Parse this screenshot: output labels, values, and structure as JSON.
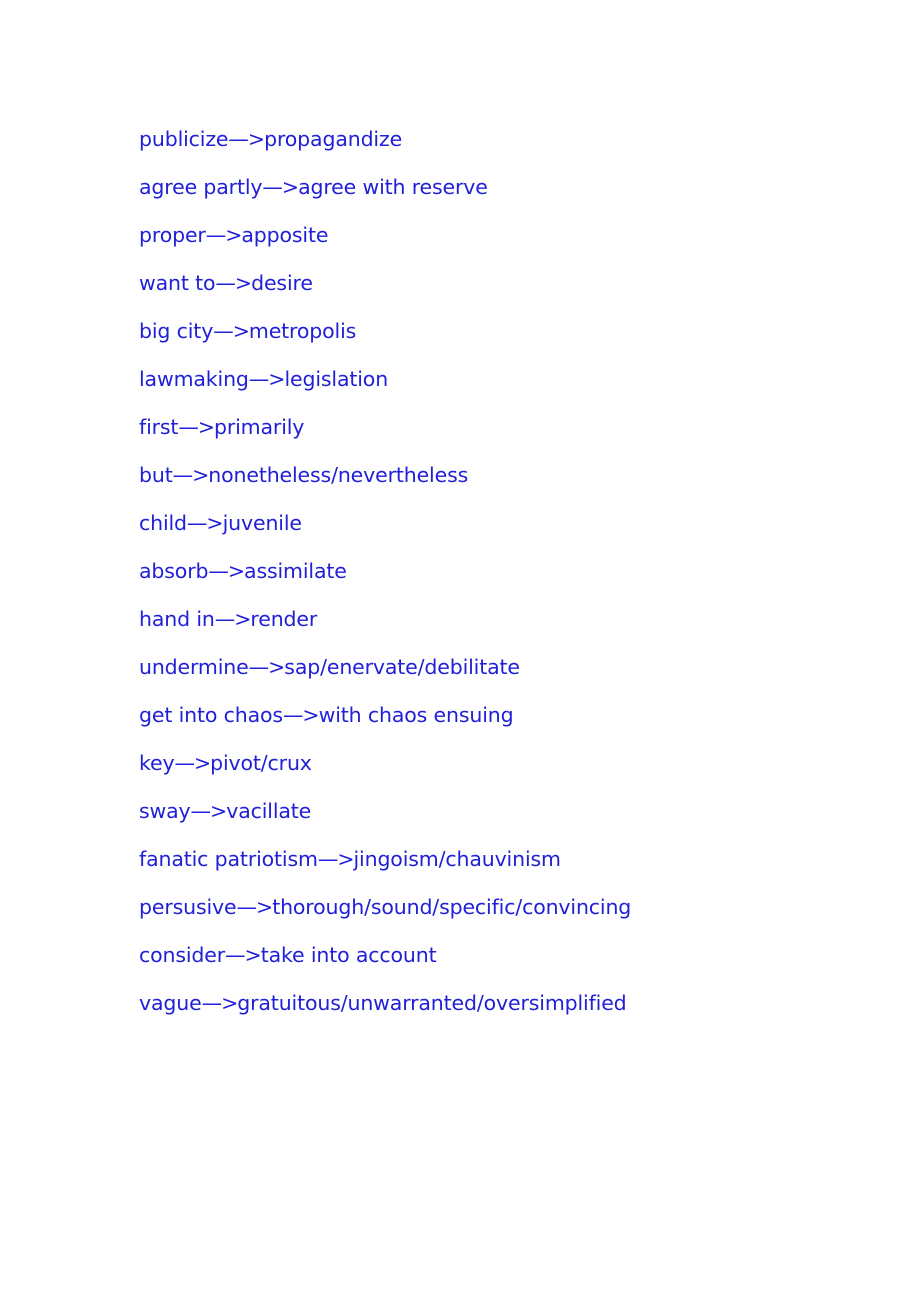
{
  "page": {
    "background_color": "#ffffff",
    "text_color": "#2020d8",
    "kind": "scanned-document-page"
  },
  "vocab_list": {
    "separator": "—>",
    "entries": [
      {
        "source": "publicize",
        "target": "propagandize"
      },
      {
        "source": "agree partly",
        "target": "agree with reserve"
      },
      {
        "source": "proper",
        "target": "apposite"
      },
      {
        "source": "want to",
        "target": "desire"
      },
      {
        "source": "big city",
        "target": "metropolis"
      },
      {
        "source": "lawmaking",
        "target": "legislation"
      },
      {
        "source": "first",
        "target": "primarily"
      },
      {
        "source": "but",
        "target": "nonetheless/nevertheless"
      },
      {
        "source": "child",
        "target": "juvenile"
      },
      {
        "source": "absorb",
        "target": "assimilate"
      },
      {
        "source": "hand in",
        "target": "render"
      },
      {
        "source": "undermine",
        "target": "sap/enervate/debilitate"
      },
      {
        "source": "get into chaos",
        "target": "with chaos ensuing"
      },
      {
        "source": "key",
        "target": "pivot/crux"
      },
      {
        "source": "sway",
        "target": "vacillate"
      },
      {
        "source": "fanatic patriotism",
        "target": "jingoism/chauvinism"
      },
      {
        "source": "persusive",
        "target": "thorough/sound/specific/convincing"
      },
      {
        "source": "consider",
        "target": "take into account"
      },
      {
        "source": "vague",
        "target": "gratuitous/unwarranted/oversimplified"
      }
    ]
  }
}
